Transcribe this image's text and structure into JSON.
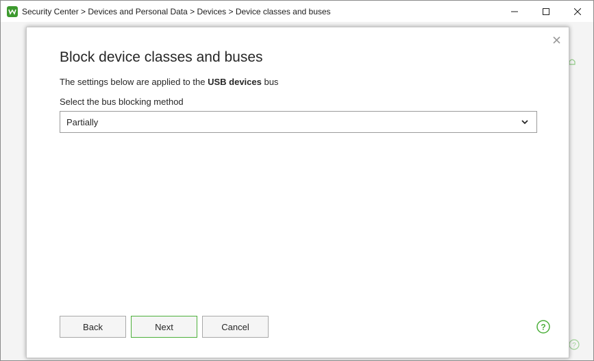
{
  "window": {
    "title": "Security Center > Devices and Personal Data > Devices > Device classes and buses",
    "controls": [
      "minimize",
      "maximize",
      "close"
    ]
  },
  "dialog": {
    "title": "Block device classes and buses",
    "description_prefix": "The settings below are applied to the ",
    "description_bold": "USB devices",
    "description_suffix": " bus",
    "method_label": "Select the bus blocking method",
    "method_value": "Partially",
    "buttons": {
      "back": "Back",
      "next": "Next",
      "cancel": "Cancel"
    }
  },
  "colors": {
    "accent_green": "#4caf3a",
    "text": "#262626"
  },
  "icons": {
    "app": "app-logo-icon",
    "close": "close-icon",
    "chevron": "chevron-down-icon",
    "help": "help-icon",
    "bell": "bell-icon"
  }
}
